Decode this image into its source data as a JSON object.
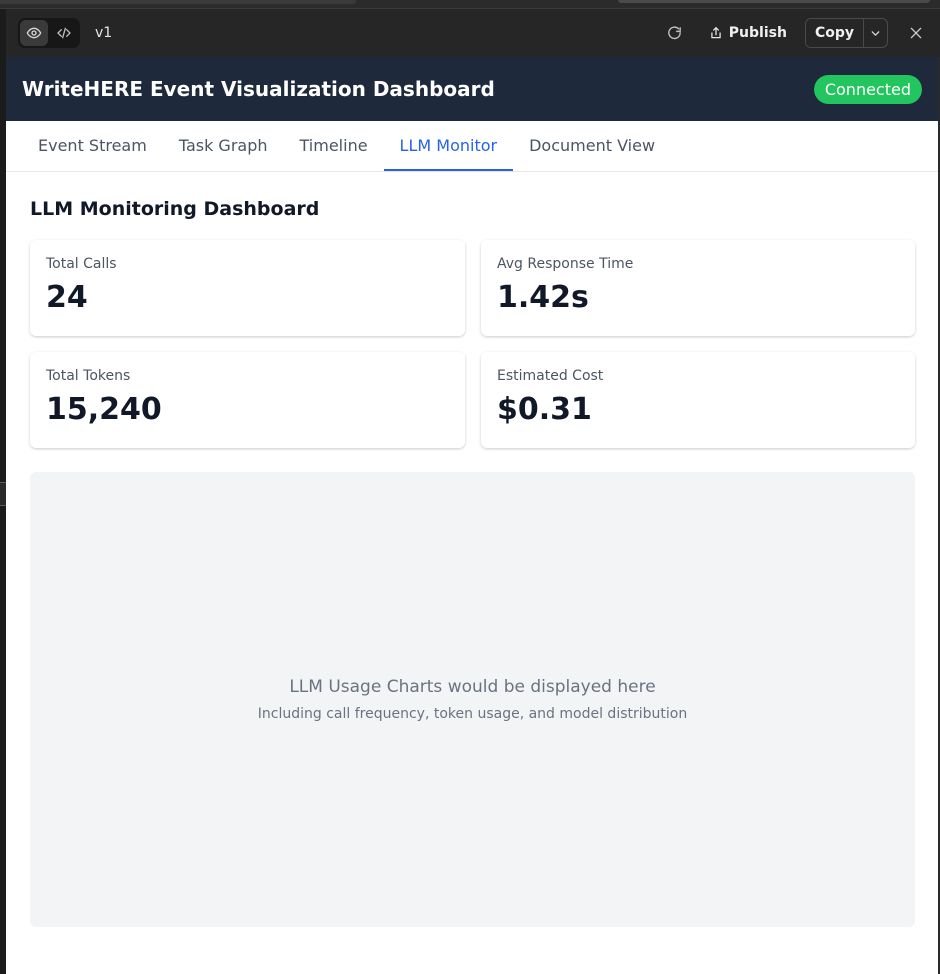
{
  "toolbar": {
    "version": "v1",
    "publish_label": "Publish",
    "copy_label": "Copy",
    "icons": {
      "preview": "eye-icon",
      "code": "code-icon",
      "refresh": "refresh-icon",
      "publish": "share-icon",
      "caret": "chevron-down-icon",
      "close": "close-icon"
    }
  },
  "header": {
    "title": "WriteHERE Event Visualization Dashboard",
    "status": "Connected",
    "status_color": "#22c55e",
    "background": "#1e293b"
  },
  "tabs": [
    {
      "label": "Event Stream",
      "active": false
    },
    {
      "label": "Task Graph",
      "active": false
    },
    {
      "label": "Timeline",
      "active": false
    },
    {
      "label": "LLM Monitor",
      "active": true
    },
    {
      "label": "Document View",
      "active": false
    }
  ],
  "accent_color": "#2563eb",
  "main": {
    "section_title": "LLM Monitoring Dashboard",
    "stats": [
      {
        "label": "Total Calls",
        "value": "24"
      },
      {
        "label": "Avg Response Time",
        "value": "1.42s"
      },
      {
        "label": "Total Tokens",
        "value": "15,240"
      },
      {
        "label": "Estimated Cost",
        "value": "$0.31"
      }
    ],
    "placeholder": {
      "title": "LLM Usage Charts would be displayed here",
      "subtitle": "Including call frequency, token usage, and model distribution"
    }
  }
}
